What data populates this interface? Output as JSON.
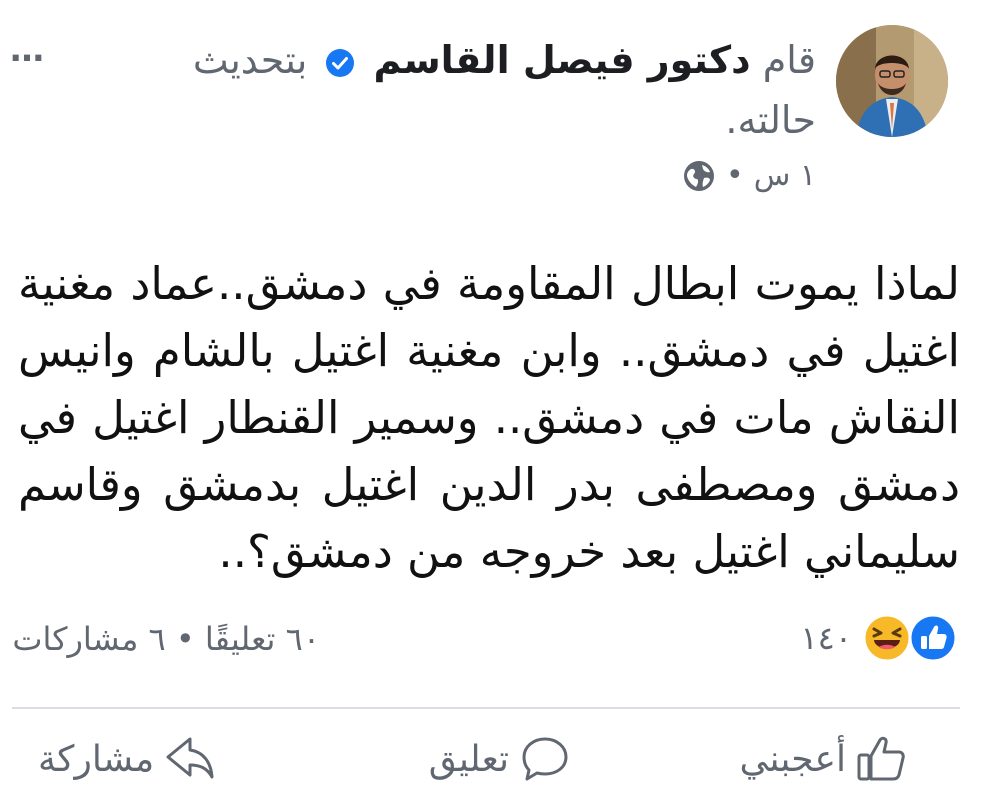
{
  "post": {
    "author": {
      "prefix": "قام",
      "name": "دكتور فيصل القاسم",
      "verified": true,
      "action": "بتحديث حالته."
    },
    "more_icon": "…",
    "time": "١ س",
    "separator": "•",
    "privacy_icon": "globe-icon",
    "text": "لماذا يموت ابطال المقاومة في دمشق..عماد مغنية اغتيل في دمشق.. وابن مغنية اغتيل بالشام وانيس النقاش مات في دمشق.. وسمير القنطار اغتيل في دمشق ومصطفى بدر الدين اغتيل بدمشق  وقاسم سليماني اغتيل بعد خروجه من دمشق؟..",
    "reactions": {
      "count": "١٤٠",
      "icons": [
        "like-icon",
        "haha-icon"
      ]
    },
    "stats": {
      "comments": "٦٠ تعليقًا",
      "dot": "•",
      "shares": "٦ مشاركات"
    },
    "actions": {
      "like": "أعجبني",
      "comment": "تعليق",
      "share": "مشاركة"
    }
  },
  "colors": {
    "facebook_blue": "#1877f2",
    "secondary_text": "#606770",
    "haha_yellow": "#f7b928"
  }
}
